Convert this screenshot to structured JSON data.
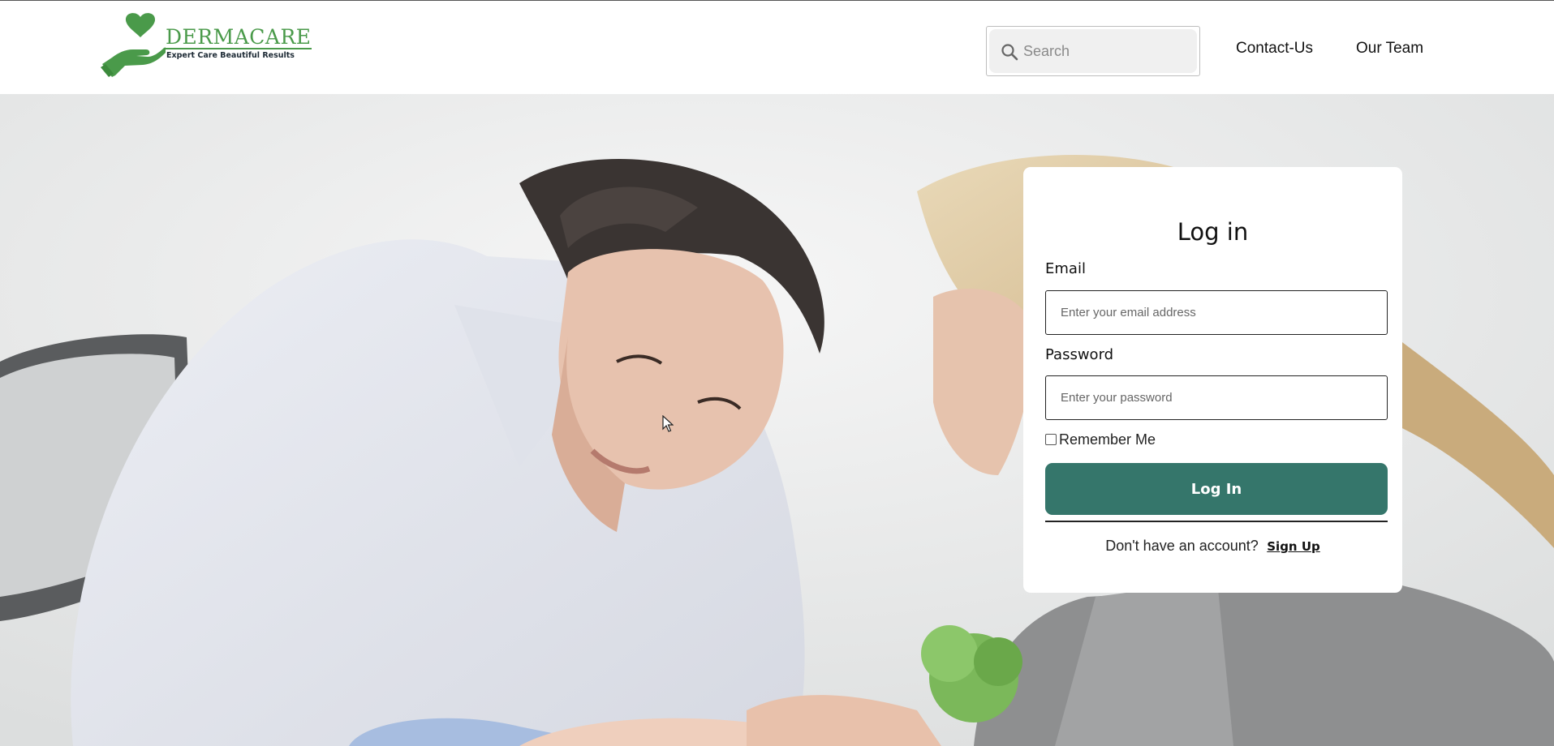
{
  "header": {
    "logo": {
      "brand_name": "DERMACARE",
      "tagline": "Expert Care Beautiful Results",
      "icon": "heart-in-hand-icon",
      "color": "#4a9a4a"
    },
    "search": {
      "placeholder": "Search",
      "icon": "search-icon"
    },
    "nav": {
      "contact": "Contact-Us",
      "team": "Our Team"
    }
  },
  "hero": {
    "image": "dermatologist-examining-patient-hand-photo"
  },
  "login": {
    "title": "Log in",
    "email_label": "Email",
    "email_placeholder": "Enter your email address",
    "password_label": "Password",
    "password_placeholder": "Enter your password",
    "remember_label": "Remember Me",
    "remember_checked": false,
    "submit_label": "Log In",
    "signup_prompt": "Don't have an account?",
    "signup_link": "Sign Up",
    "accent_color": "#35766b"
  }
}
